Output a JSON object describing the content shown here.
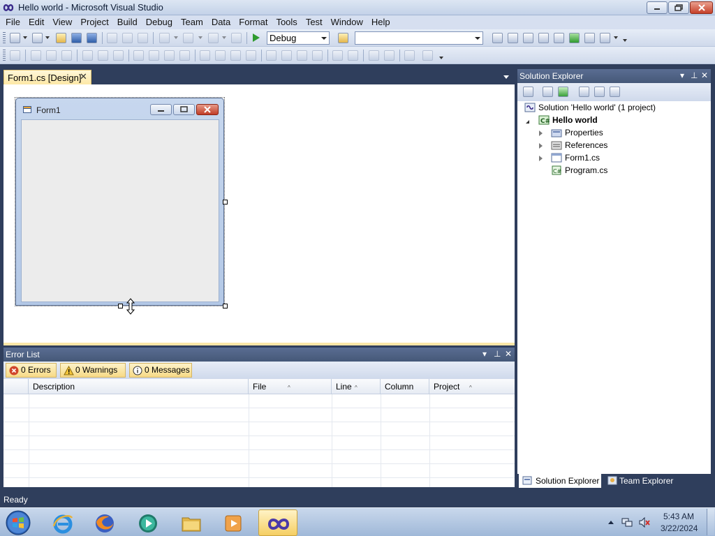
{
  "window": {
    "title": "Hello world - Microsoft Visual Studio",
    "icon": "visual-studio-infinity-icon"
  },
  "menu": [
    "File",
    "Edit",
    "View",
    "Project",
    "Build",
    "Debug",
    "Team",
    "Data",
    "Format",
    "Tools",
    "Test",
    "Window",
    "Help"
  ],
  "toolbar": {
    "configuration": "Debug",
    "platform": "",
    "start_icon": "start-debugging-icon"
  },
  "document": {
    "tab_label": "Form1.cs [Design]",
    "close_glyph": "✕",
    "form_title": "Form1"
  },
  "error_list": {
    "title": "Error List",
    "filters": {
      "errors": "0 Errors",
      "warnings": "0 Warnings",
      "messages": "0 Messages"
    },
    "columns": [
      "Description",
      "File",
      "Line",
      "Column",
      "Project"
    ],
    "rows": []
  },
  "solution_explorer": {
    "title": "Solution Explorer",
    "solution": "Solution 'Hello world' (1 project)",
    "project": "Hello world",
    "items": [
      "Properties",
      "References",
      "Form1.cs",
      "Program.cs"
    ]
  },
  "tool_tabs": {
    "solution_explorer": "Solution Explorer",
    "team_explorer": "Team Explorer"
  },
  "status": {
    "text": "Ready"
  },
  "taskbar": {
    "apps": [
      "internet-explorer-icon",
      "firefox-icon",
      "media-player-icon",
      "file-explorer-icon",
      "video-player-icon",
      "visual-studio-icon"
    ],
    "time": "5:43 AM",
    "date": "3/22/2024"
  },
  "colors": {
    "ide_frame": "#2f3e5c",
    "pane_header": "#4d6185",
    "active_tab": "#fde8a6"
  }
}
